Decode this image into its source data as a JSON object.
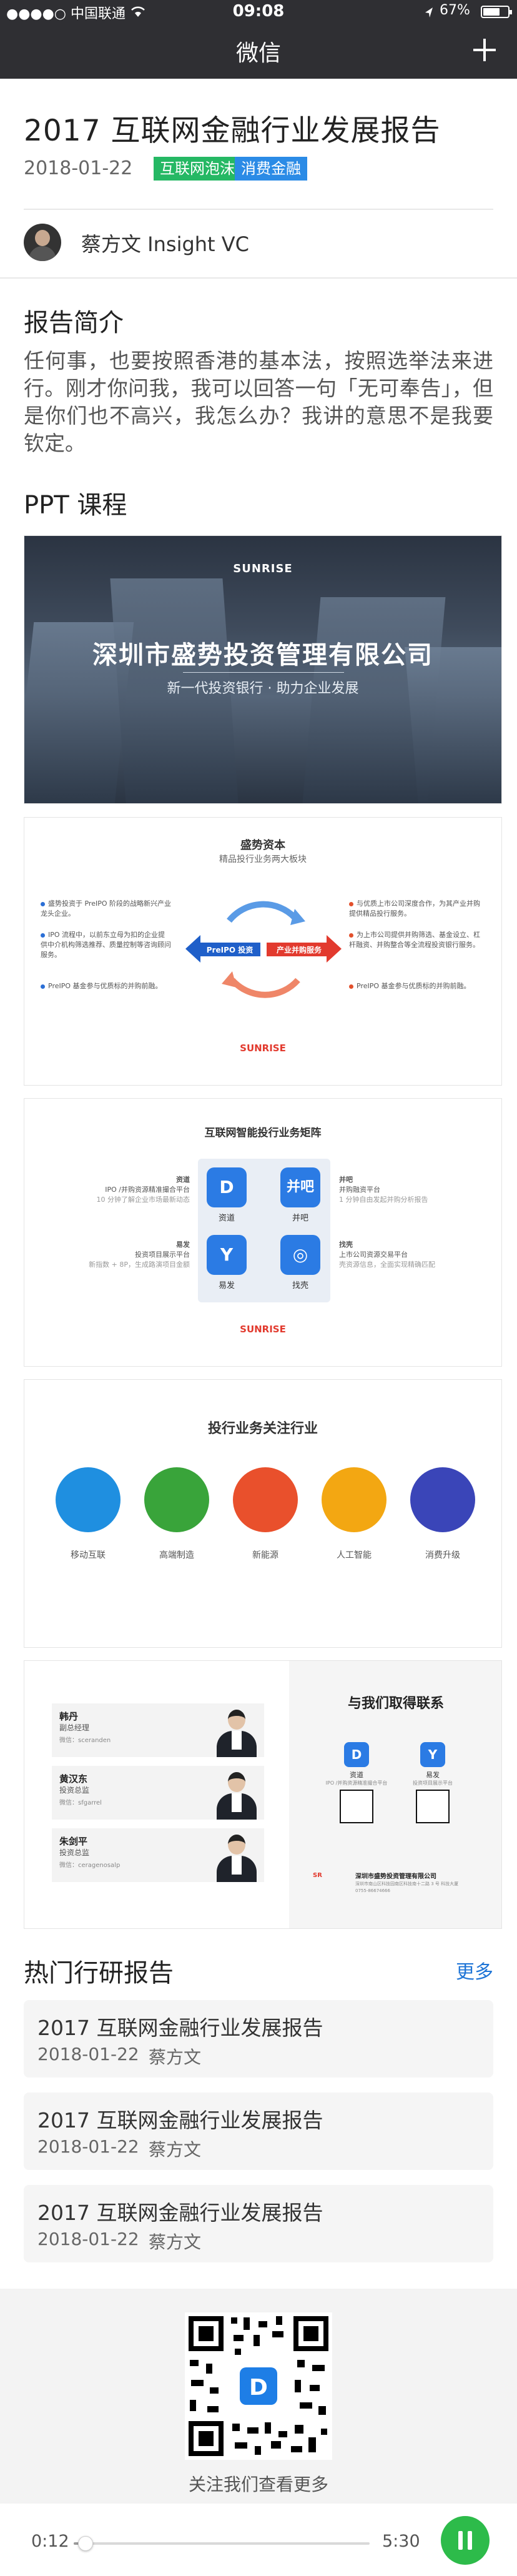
{
  "status_bar": {
    "carrier": "●●●●○ 中国联通",
    "time": "09:08",
    "battery": "67%"
  },
  "nav": {
    "title": "微信",
    "plus_icon": "plus-icon"
  },
  "article": {
    "title": "2017 互联网金融行业发展报告",
    "date": "2018-01-22",
    "tags": [
      {
        "label": "互联网泡沫",
        "color": "#25b864"
      },
      {
        "label": "消费金融",
        "color": "#2b8be6"
      }
    ],
    "author": "蔡方文  Insight VC"
  },
  "intro": {
    "heading": "报告简介",
    "text": "任何事，也要按照香港的基本法，按照选举法来进行。刚才你问我，我可以回答一句「无可奉告」，但是你们也不高兴，我怎么办？我讲的意思不是我要钦定。"
  },
  "ppt": {
    "heading": "PPT 课程",
    "slide1": {
      "logo": "SUNRISE",
      "title": "深圳市盛势投资管理有限公司",
      "subtitle": "新一代投资银行 · 助力企业发展"
    },
    "slide2": {
      "title": "盛势资本",
      "subtitle": "精品投行业务两大板块",
      "left_items": [
        "盛势投资于 PreIPO 阶段的战略新兴产业龙头企业。",
        "IPO 流程中，以前东立母为扣的企业提供中介机构筛选推荐、质量控制等咨询顾问服务。",
        "PreIPO 基金参与优质标的并购前融。"
      ],
      "right_items": [
        "与优质上市公司深度合作，为其产业并购提供精品投行服务。",
        "为上市公司提供并购筛选、基金设立、杠杆融资、并购整合等全流程投资银行服务。",
        "PreIPO 基金参与优质标的并购前融。"
      ],
      "arrow_left": "PreIPO 投资",
      "arrow_right": "产业并购服务",
      "brand": "SUNRISE"
    },
    "slide3": {
      "title": "互联网智能投行业务矩阵",
      "blocks": [
        {
          "name": "资道",
          "desc": "IPO /并购资源精准撮合平台",
          "note": "10 分钟了解企业市场最新动态"
        },
        {
          "name": "并吧",
          "desc": "并购融资平台",
          "note": "1 分钟自由发起并购分析报告"
        },
        {
          "name": "易发",
          "desc": "投资项目展示平台",
          "note": "新指数 + 8P，生成路演项目金额"
        },
        {
          "name": "找壳",
          "desc": "上市公司资源交易平台",
          "note": "壳资源信息，全面实现精确匹配"
        }
      ],
      "apps": [
        "资道",
        "并吧",
        "易发",
        "找壳"
      ],
      "brand": "SUNRISE"
    },
    "slide4": {
      "title": "投行业务关注行业",
      "industries": [
        {
          "label": "移动互联",
          "color": "#1f8fe0"
        },
        {
          "label": "高端制造",
          "color": "#39a43a"
        },
        {
          "label": "新能源",
          "color": "#e9502c"
        },
        {
          "label": "人工智能",
          "color": "#f3a712"
        },
        {
          "label": "消费升级",
          "color": "#3a45b8"
        }
      ]
    },
    "slide5": {
      "title": "与我们取得联系",
      "people": [
        {
          "name": "韩丹",
          "role": "副总经理",
          "wechat": "微信：sceranden"
        },
        {
          "name": "黄汉东",
          "role": "投资总监",
          "wechat": "微信：sfgarrel"
        },
        {
          "name": "朱剑平",
          "role": "投资总监",
          "wechat": "微信：ceragenosalp"
        }
      ],
      "apps": [
        {
          "name": "资道",
          "desc": "IPO /并购资源精准撮合平台"
        },
        {
          "name": "易发",
          "desc": "投资项目展示平台"
        }
      ],
      "company": "深圳市盛势投资管理有限公司",
      "address": "深圳市南山区科技园南区科技南十二路 3 号 科技大厦",
      "phone": "0755-86674666"
    }
  },
  "hot": {
    "heading": "热门行研报告",
    "more_label": "更多",
    "items": [
      {
        "title": "2017 互联网金融行业发展报告",
        "date": "2018-01-22",
        "author": "蔡方文"
      },
      {
        "title": "2017 互联网金融行业发展报告",
        "date": "2018-01-22",
        "author": "蔡方文"
      },
      {
        "title": "2017 互联网金融行业发展报告",
        "date": "2018-01-22",
        "author": "蔡方文"
      }
    ]
  },
  "footer": {
    "caption": "关注我们查看更多"
  },
  "player": {
    "current": "0:12",
    "duration": "5:30",
    "progress": 0.04
  }
}
